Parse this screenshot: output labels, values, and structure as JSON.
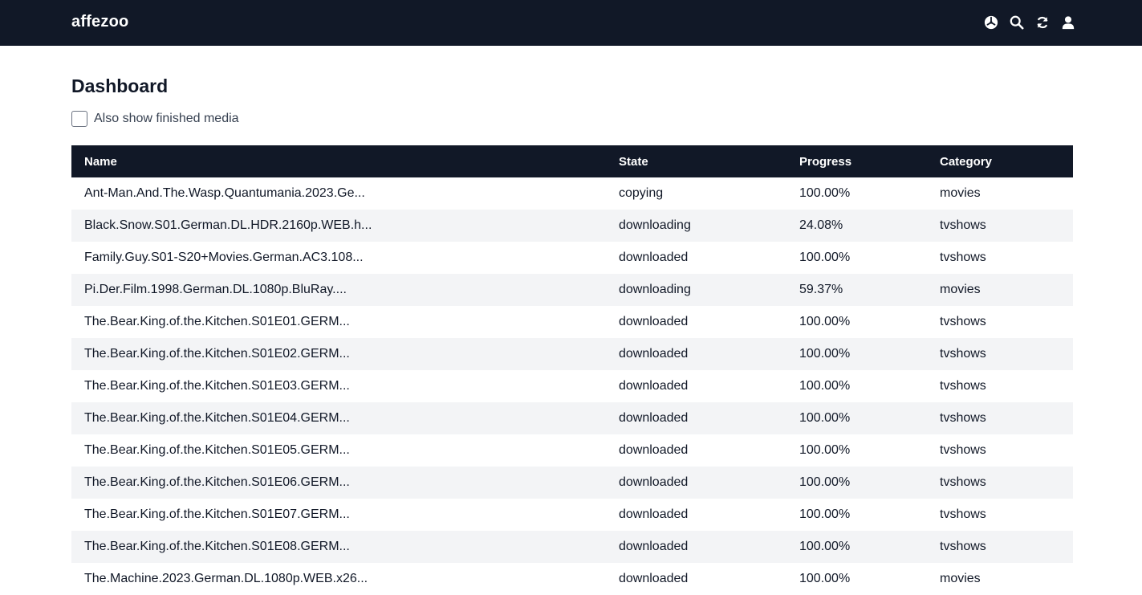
{
  "app": {
    "brand": "affezoo"
  },
  "nav": {
    "icons": [
      "dashboard-icon",
      "search-icon",
      "refresh-icon",
      "user-icon"
    ]
  },
  "page": {
    "title": "Dashboard",
    "filter_label": "Also show finished media",
    "filter_checked": false
  },
  "table": {
    "columns": [
      "Name",
      "State",
      "Progress",
      "Category"
    ],
    "rows": [
      [
        "Ant-Man.And.The.Wasp.Quantumania.2023.Ge...",
        "copying",
        "100.00%",
        "movies"
      ],
      [
        "Black.Snow.S01.German.DL.HDR.2160p.WEB.h...",
        "downloading",
        "24.08%",
        "tvshows"
      ],
      [
        "Family.Guy.S01-S20+Movies.German.AC3.108...",
        "downloaded",
        "100.00%",
        "tvshows"
      ],
      [
        "Pi.Der.Film.1998.German.DL.1080p.BluRay....",
        "downloading",
        "59.37%",
        "movies"
      ],
      [
        "The.Bear.King.of.the.Kitchen.S01E01.GERM...",
        "downloaded",
        "100.00%",
        "tvshows"
      ],
      [
        "The.Bear.King.of.the.Kitchen.S01E02.GERM...",
        "downloaded",
        "100.00%",
        "tvshows"
      ],
      [
        "The.Bear.King.of.the.Kitchen.S01E03.GERM...",
        "downloaded",
        "100.00%",
        "tvshows"
      ],
      [
        "The.Bear.King.of.the.Kitchen.S01E04.GERM...",
        "downloaded",
        "100.00%",
        "tvshows"
      ],
      [
        "The.Bear.King.of.the.Kitchen.S01E05.GERM...",
        "downloaded",
        "100.00%",
        "tvshows"
      ],
      [
        "The.Bear.King.of.the.Kitchen.S01E06.GERM...",
        "downloaded",
        "100.00%",
        "tvshows"
      ],
      [
        "The.Bear.King.of.the.Kitchen.S01E07.GERM...",
        "downloaded",
        "100.00%",
        "tvshows"
      ],
      [
        "The.Bear.King.of.the.Kitchen.S01E08.GERM...",
        "downloaded",
        "100.00%",
        "tvshows"
      ],
      [
        "The.Machine.2023.German.DL.1080p.WEB.x26...",
        "downloaded",
        "100.00%",
        "movies"
      ]
    ]
  },
  "colors": {
    "header_bg": "#111827",
    "row_alt_bg": "#f3f4f6",
    "text": "#111827"
  }
}
